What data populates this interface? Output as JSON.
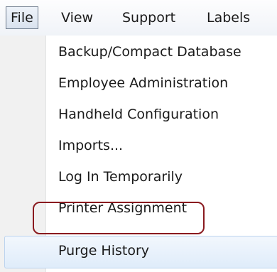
{
  "menubar": {
    "items": [
      {
        "label": "File"
      },
      {
        "label": "View"
      },
      {
        "label": "Support"
      },
      {
        "label": "Labels"
      }
    ]
  },
  "file_menu": {
    "items": [
      {
        "label": "Backup/Compact Database"
      },
      {
        "label": "Employee Administration"
      },
      {
        "label": "Handheld Configuration"
      },
      {
        "label": "Imports..."
      },
      {
        "label": "Log In Temporarily"
      },
      {
        "label": "Printer Assignment"
      },
      {
        "label": "Purge History",
        "highlighted": true
      }
    ]
  },
  "colors": {
    "annotation_border": "#8a1a1f",
    "hover_fill": "#dfecfa",
    "gutter": "#f1f1f1"
  }
}
